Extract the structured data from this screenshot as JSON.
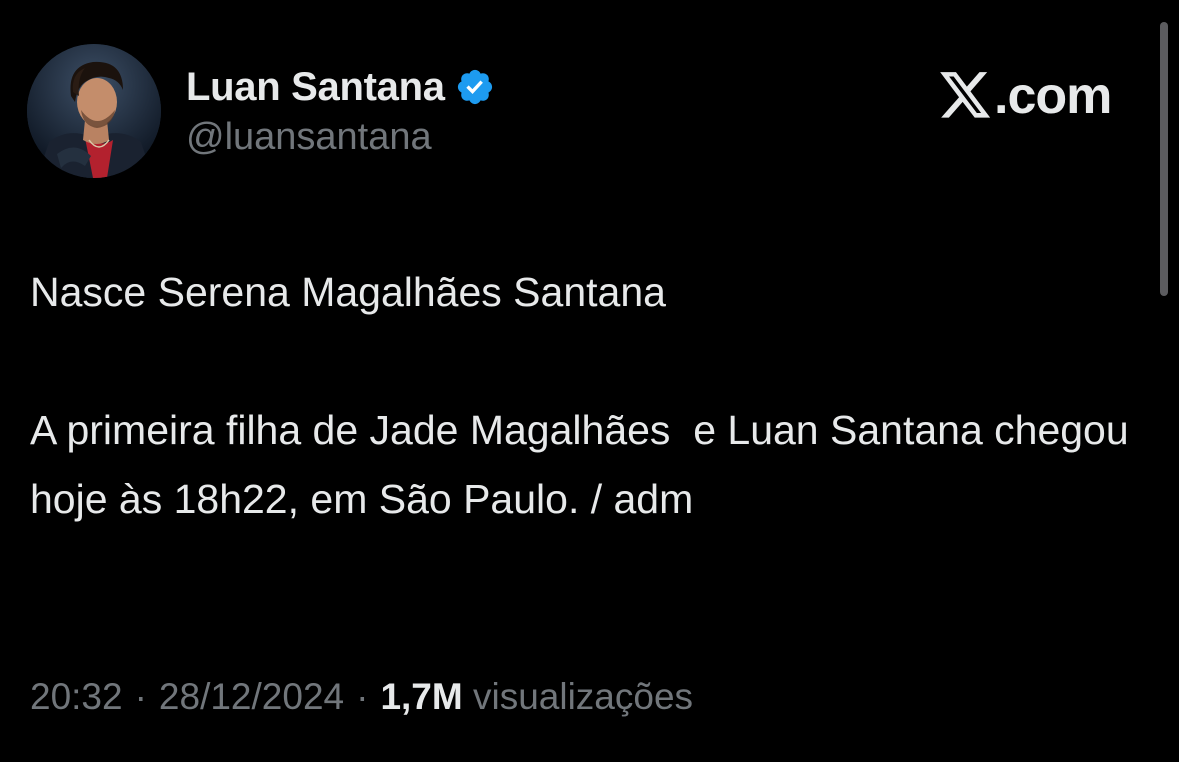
{
  "author": {
    "display_name": "Luan Santana",
    "handle": "@luansantana",
    "verified": true,
    "avatar": "profile-photo",
    "verified_badge_color": "#1d9bf0"
  },
  "brand": {
    "icon": "x-logo-icon",
    "text": ".com"
  },
  "tweet": {
    "paragraphs": [
      "Nasce Serena Magalhães Santana",
      "A primeira filha de Jade Magalhães  e Luan Santana chegou hoje às 18h22, em São Paulo. / adm"
    ]
  },
  "meta": {
    "time": "20:32",
    "separator": "·",
    "date": "28/12/2024",
    "views_count": "1,7M",
    "views_label": "visualizações"
  },
  "colors": {
    "background": "#000000",
    "text_primary": "#e7e9ea",
    "text_secondary": "#71767b"
  }
}
